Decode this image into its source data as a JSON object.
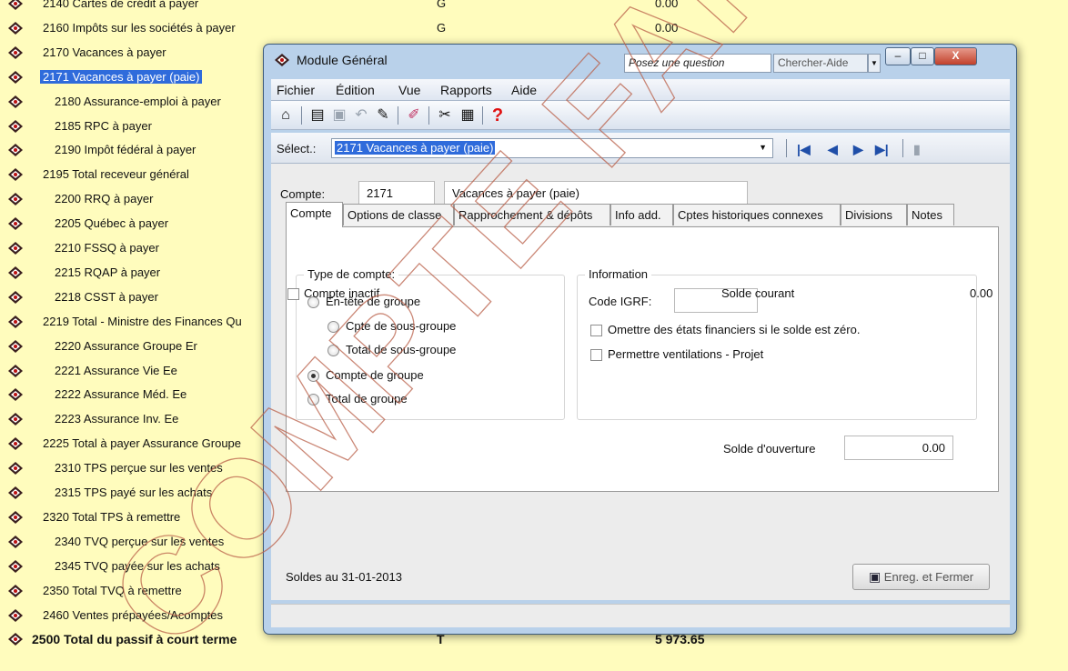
{
  "accounts": [
    {
      "label": "2140 Cartes de crédit à payer",
      "type": "G",
      "balance": "0.00"
    },
    {
      "label": "2160 Impôts sur les sociétés à payer",
      "type": "G",
      "balance": "0.00"
    },
    {
      "label": "2170 Vacances à payer",
      "type": "",
      "balance": ""
    },
    {
      "label": "2171 Vacances à payer (paie)",
      "type": "",
      "balance": ""
    },
    {
      "label": "2180 Assurance-emploi à payer",
      "type": "",
      "balance": ""
    },
    {
      "label": "2185 RPC à payer",
      "type": "",
      "balance": ""
    },
    {
      "label": "2190 Impôt fédéral à payer",
      "type": "",
      "balance": ""
    },
    {
      "label": "2195 Total receveur général",
      "type": "",
      "balance": ""
    },
    {
      "label": "2200 RRQ à payer",
      "type": "",
      "balance": ""
    },
    {
      "label": "2205 Québec à payer",
      "type": "",
      "balance": ""
    },
    {
      "label": "2210 FSSQ à payer",
      "type": "",
      "balance": ""
    },
    {
      "label": "2215 RQAP à payer",
      "type": "",
      "balance": ""
    },
    {
      "label": "2218 CSST à payer",
      "type": "",
      "balance": ""
    },
    {
      "label": "2219 Total - Ministre des Finances Qu",
      "type": "",
      "balance": ""
    },
    {
      "label": "2220 Assurance Groupe Er",
      "type": "",
      "balance": ""
    },
    {
      "label": "2221 Assurance Vie Ee",
      "type": "",
      "balance": ""
    },
    {
      "label": "2222 Assurance Méd. Ee",
      "type": "",
      "balance": ""
    },
    {
      "label": "2223 Assurance Inv. Ee",
      "type": "",
      "balance": ""
    },
    {
      "label": "2225 Total à payer Assurance Groupe",
      "type": "",
      "balance": ""
    },
    {
      "label": "2310 TPS perçue sur les ventes",
      "type": "",
      "balance": ""
    },
    {
      "label": "2315 TPS payé sur les achats",
      "type": "",
      "balance": ""
    },
    {
      "label": "2320 Total TPS à remettre",
      "type": "",
      "balance": ""
    },
    {
      "label": "2340 TVQ perçue sur les ventes",
      "type": "",
      "balance": ""
    },
    {
      "label": "2345 TVQ payée sur les achats",
      "type": "",
      "balance": ""
    },
    {
      "label": "2350 Total TVQ à remettre",
      "type": "",
      "balance": ""
    },
    {
      "label": "2460 Ventes prépayées/Acomptes",
      "type": "",
      "balance": ""
    },
    {
      "label": "2500 Total du passif à court terme",
      "type": "T",
      "balance": "5 973.65"
    }
  ],
  "window": {
    "title": "Module Général",
    "ask_placeholder": "Posez une question",
    "help_button": "Chercher-Aide",
    "close_glyph": "X",
    "min_glyph": "–",
    "max_glyph": "□"
  },
  "menu": [
    "Fichier",
    "Édition",
    "Vue",
    "Rapports",
    "Aide"
  ],
  "toolbar_icons": [
    "home-icon",
    "open-icon",
    "save-icon",
    "undo-icon",
    "lookup-icon",
    "edit-icon",
    "tools-icon",
    "calculator-icon",
    "help-icon"
  ],
  "select": {
    "label": "Sélect.:",
    "value": "2171 Vacances à payer (paie)"
  },
  "account": {
    "label": "Compte:",
    "number": "2171",
    "name": "Vacances à payer (paie)"
  },
  "tabs": [
    "Compte",
    "Options de classe",
    "Rapprochement & dépôts",
    "Info add.",
    "Cptes historiques connexes",
    "Divisions",
    "Notes"
  ],
  "account_type": {
    "title": "Type de compte:",
    "options": [
      {
        "label": "En-tête de groupe",
        "checked": false
      },
      {
        "label": "Cpte de sous-groupe",
        "checked": false
      },
      {
        "label": "Total de sous-groupe",
        "checked": false
      },
      {
        "label": "Compte de groupe",
        "checked": true
      },
      {
        "label": "Total de groupe",
        "checked": false
      }
    ]
  },
  "information": {
    "title": "Information",
    "code_label": "Code IGRF:",
    "code_value": "",
    "omit_label": "Omettre des états financiers si le solde est zéro.",
    "omit_checked": false,
    "allocate_label": "Permettre ventilations - Projet",
    "allocate_checked": false
  },
  "opening_balance": {
    "label": "Solde d'ouverture",
    "value": "0.00"
  },
  "inactive": {
    "label": "Compte inactif",
    "checked": false
  },
  "current_balance": {
    "label": "Solde courant",
    "value": "0.00"
  },
  "balances_date": "Soldes au 31-01-2013",
  "save_button": "Enreg. et Fermer",
  "watermark": "COMPTE FAIT CONSULTANT",
  "colors": {
    "background": "#fffcbd",
    "selection": "#2f6bdb",
    "window_frame": "#b9d1ea",
    "help_red": "#e01010"
  }
}
